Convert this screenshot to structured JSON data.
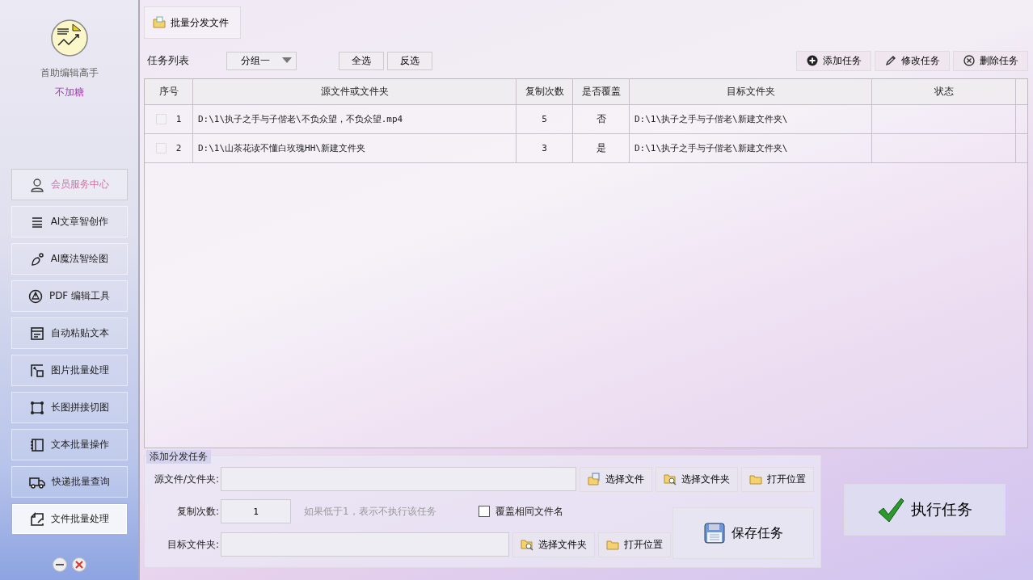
{
  "sidebar": {
    "app_name": "首助编辑高手",
    "user_name": "不加糖",
    "items": [
      {
        "label": "会员服务中心",
        "kind": "member",
        "selected": false
      },
      {
        "label": "AI文章智创作",
        "kind": "nav",
        "selected": false
      },
      {
        "label": "AI魔法智绘图",
        "kind": "nav",
        "selected": false
      },
      {
        "label": "PDF 编辑工具",
        "kind": "nav",
        "selected": false
      },
      {
        "label": "自动粘贴文本",
        "kind": "nav",
        "selected": false
      },
      {
        "label": "图片批量处理",
        "kind": "nav",
        "selected": false
      },
      {
        "label": "长图拼接切图",
        "kind": "nav",
        "selected": false
      },
      {
        "label": "文本批量操作",
        "kind": "nav",
        "selected": false
      },
      {
        "label": "快递批量查询",
        "kind": "nav",
        "selected": false
      },
      {
        "label": "文件批量处理",
        "kind": "nav",
        "selected": true
      }
    ]
  },
  "top_tab": {
    "label": "批量分发文件"
  },
  "toolbar": {
    "title": "任务列表",
    "group_select": "分组一",
    "select_all": "全选",
    "invert": "反选",
    "actions": [
      "添加任务",
      "修改任务",
      "删除任务"
    ]
  },
  "table": {
    "columns": [
      "序号",
      "源文件或文件夹",
      "复制次数",
      "是否覆盖",
      "目标文件夹",
      "状态"
    ],
    "rows": [
      {
        "checked": false,
        "index": "1",
        "source": "D:\\1\\执子之手与子偕老\\不负众望，不负众望.mp4",
        "copies": "5",
        "overwrite": "否",
        "target": "D:\\1\\执子之手与子偕老\\新建文件夹\\"
      },
      {
        "checked": false,
        "index": "2",
        "source": "D:\\1\\山茶花读不懂白玫瑰HH\\新建文件夹",
        "copies": "3",
        "overwrite": "是",
        "target": "D:\\1\\执子之手与子偕老\\新建文件夹\\"
      }
    ]
  },
  "add_panel": {
    "title": "添加分发任务",
    "source_label": "源文件/文件夹:",
    "source_buttons": [
      "选择文件",
      "选择文件夹",
      "打开位置"
    ],
    "count_label": "复制次数:",
    "count_value": "1",
    "count_hint": "如果低于1，表示不执行该任务",
    "overwrite": {
      "label": "覆盖相同文件名",
      "checked": false
    },
    "target_label": "目标文件夹:",
    "target_buttons": [
      "选择文件夹",
      "打开位置"
    ],
    "save": "保存任务"
  },
  "execute": "执行任务"
}
